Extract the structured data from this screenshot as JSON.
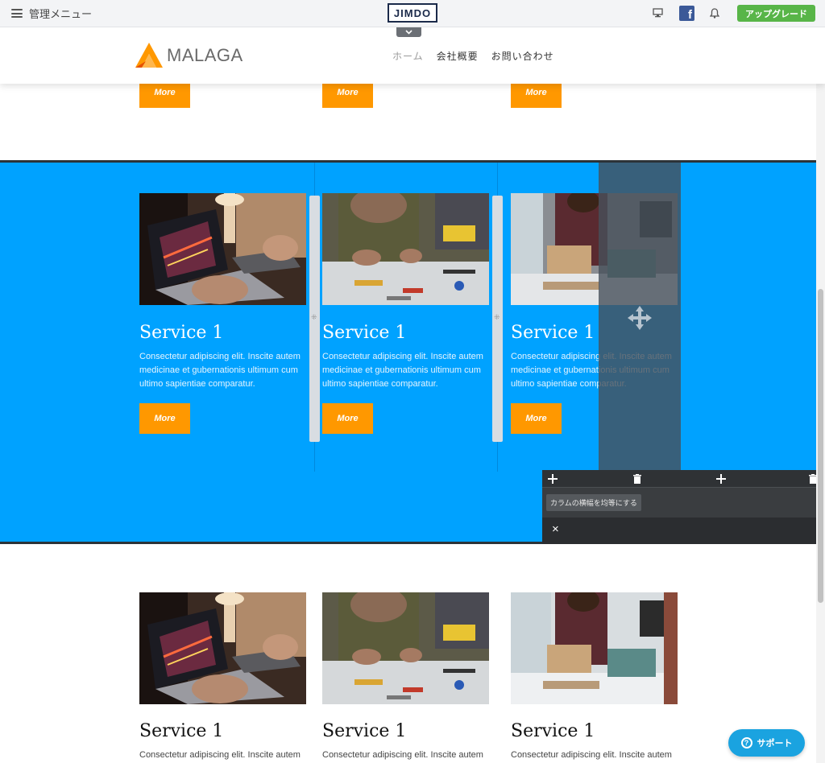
{
  "admin_bar": {
    "menu_label": "管理メニュー",
    "logo_text": "JIMDO",
    "upgrade_label": "アップグレード",
    "facebook_glyph": "f"
  },
  "site": {
    "logo_text": "MALAGA",
    "brand_color": "#ff9800",
    "nav": [
      "ホーム",
      "会社概要",
      "お問い合わせ"
    ]
  },
  "top_buttons": [
    "More",
    "More",
    "More"
  ],
  "blue_section": {
    "background": "#00a2ff",
    "cards": [
      {
        "title": "Service 1",
        "body": "Consectetur adipiscing elit. Inscite autem medicinae et gubernationis ultimum cum ultimo sapientiae comparatur.",
        "button": "More",
        "image": "laptop-drawing-tablet"
      },
      {
        "title": "Service 1",
        "body": "Consectetur adipiscing elit. Inscite autem medicinae et gubernationis ultimum cum ultimo sapientiae comparatur.",
        "button": "More",
        "image": "workshop-tools"
      },
      {
        "title": "Service 1",
        "body": "Consectetur adipiscing elit. Inscite autem medicinae et gubernationis ultimum cum ultimo sapientiae comparatur.",
        "button": "More",
        "image": "office-packing"
      }
    ]
  },
  "editor_panel": {
    "equal_width_label": "カラムの横幅を均等にする",
    "close_glyph": "×"
  },
  "lower_section": {
    "cards": [
      {
        "title": "Service 1",
        "body": "Consectetur adipiscing elit. Inscite autem"
      },
      {
        "title": "Service 1",
        "body": "Consectetur adipiscing elit. Inscite autem"
      },
      {
        "title": "Service 1",
        "body": "Consectetur adipiscing elit. Inscite autem"
      }
    ]
  },
  "support": {
    "label": "サポート",
    "glyph": "?"
  }
}
